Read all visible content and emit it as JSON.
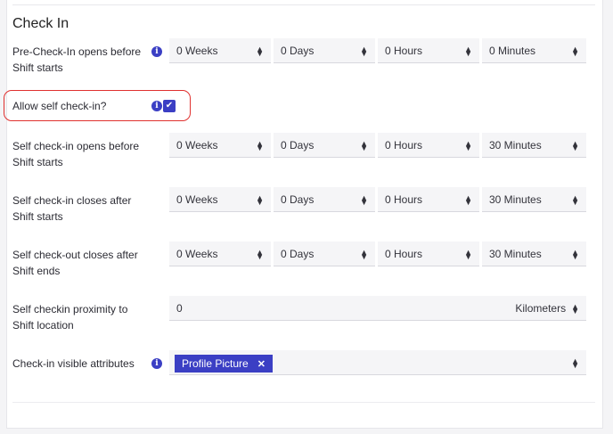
{
  "section": {
    "title": "Check In"
  },
  "rows": {
    "pre_check_in": {
      "label": "Pre-Check-In opens before Shift starts",
      "weeks": "0 Weeks",
      "days": "0 Days",
      "hours": "0 Hours",
      "minutes": "0 Minutes"
    },
    "allow_self_check_in": {
      "label": "Allow self check-in?",
      "checked": true
    },
    "self_check_in_opens": {
      "label": "Self check-in opens before Shift starts",
      "weeks": "0 Weeks",
      "days": "0 Days",
      "hours": "0 Hours",
      "minutes": "30 Minutes"
    },
    "self_check_in_closes": {
      "label": "Self check-in closes after Shift starts",
      "weeks": "0 Weeks",
      "days": "0 Days",
      "hours": "0 Hours",
      "minutes": "30 Minutes"
    },
    "self_check_out_closes": {
      "label": "Self check-out closes after Shift ends",
      "weeks": "0 Weeks",
      "days": "0 Days",
      "hours": "0 Hours",
      "minutes": "30 Minutes"
    },
    "proximity": {
      "label": "Self checkin proximity to Shift location",
      "value": "0",
      "unit": "Kilometers"
    },
    "visible_attributes": {
      "label": "Check-in visible attributes",
      "tags": [
        "Profile Picture"
      ]
    }
  },
  "icons": {
    "info": "info-icon",
    "check": "checkmark-icon",
    "select_caret": "updown-caret-icon",
    "remove": "close-icon"
  },
  "colors": {
    "accent": "#3b3fc4",
    "highlight": "#e0312f"
  }
}
